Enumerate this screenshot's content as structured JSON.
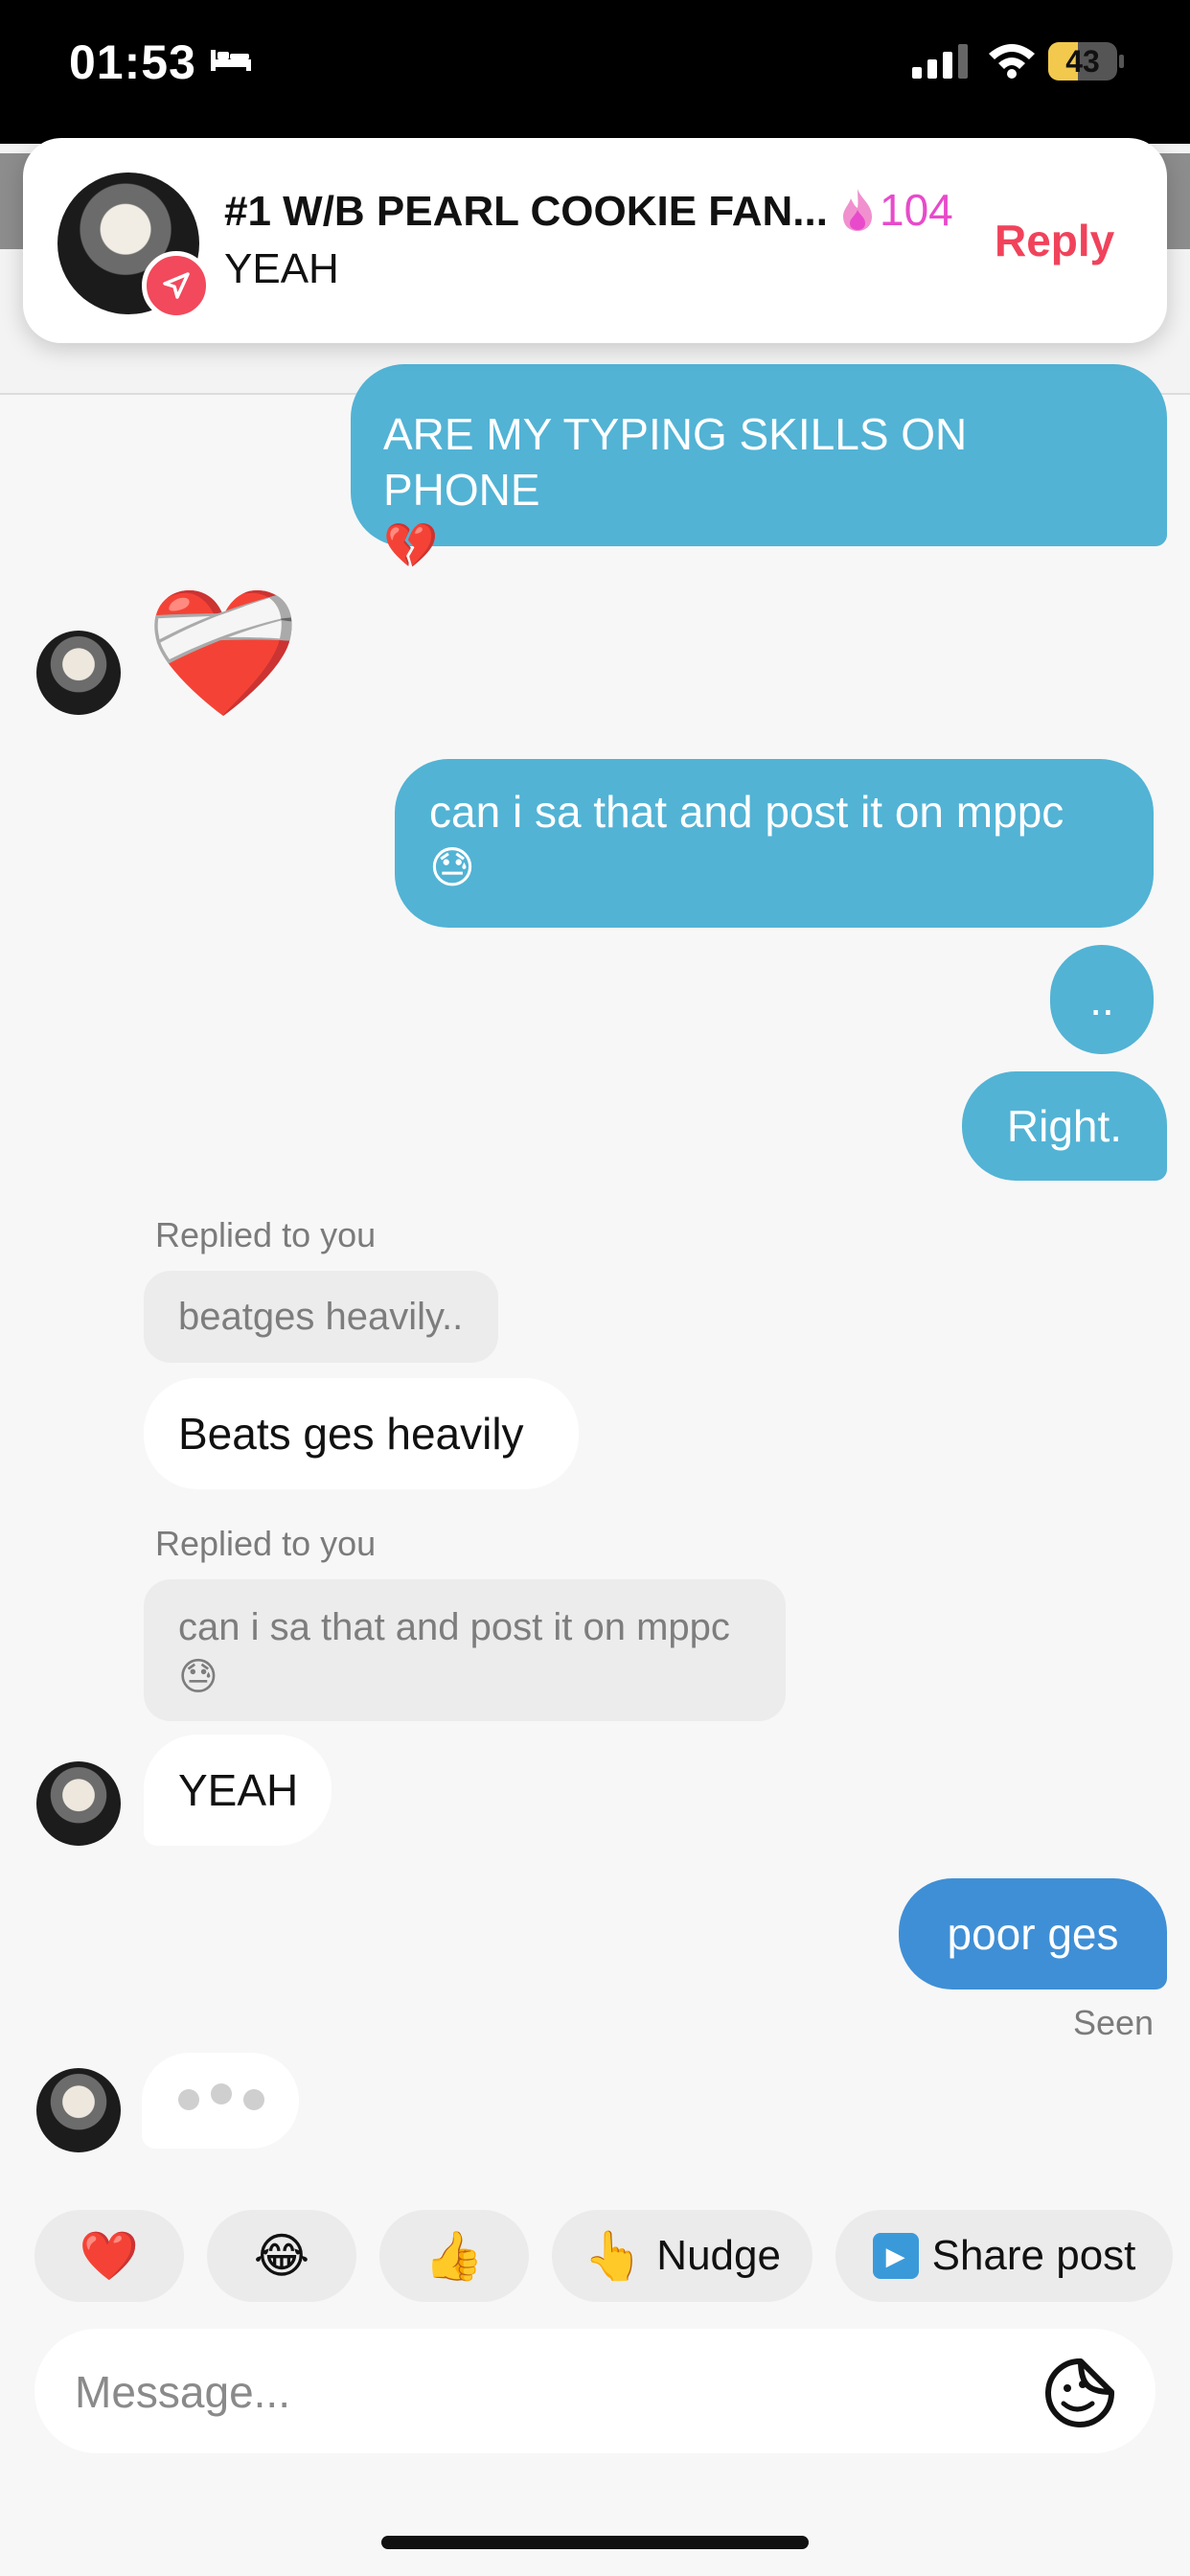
{
  "status_bar": {
    "time": "01:53",
    "battery": "43",
    "battery_level": 0.43,
    "icons": [
      "bed-icon",
      "signal-icon",
      "wifi-icon",
      "battery-icon"
    ]
  },
  "notification": {
    "title": "#1 W/B PEARL COOKIE FAN...",
    "streak_count": "104",
    "body": "YEAH",
    "reply_label": "Reply",
    "icons": [
      "flame-icon",
      "send-badge-icon"
    ]
  },
  "messages": {
    "m1_text": "ARE MY TYPING SKILLS ON PHONE",
    "m1_emoji": "💔",
    "m2_emoji": "❤️‍🩹",
    "m3_text": "can i sa that and post it on mppc",
    "m3_emoji": "😓",
    "m4_text": "..",
    "m5_text": "Right.",
    "reply1_label": "Replied to you",
    "reply1_quote": "beatges heavily..",
    "m6_text": "Beats ges heavily",
    "reply2_label": "Replied to you",
    "reply2_quote": "can i sa that and post it on mppc",
    "reply2_emoji": "😓",
    "m7_text": "YEAH",
    "m8_text": "poor ges",
    "seen_label": "Seen"
  },
  "quick_reactions": [
    {
      "emoji": "❤️",
      "label": ""
    },
    {
      "emoji": "😂",
      "label": ""
    },
    {
      "emoji": "👍",
      "label": ""
    },
    {
      "emoji": "👆",
      "label": "Nudge"
    },
    {
      "emoji": "▶",
      "label": "Share post"
    }
  ],
  "composer": {
    "placeholder": "Message...",
    "icon": "sticker-icon"
  },
  "colors": {
    "outgoing": "#52b3d5",
    "outgoing_last": "#3f8fd6",
    "accent": "#f0435b",
    "streak": "#e84acb"
  }
}
